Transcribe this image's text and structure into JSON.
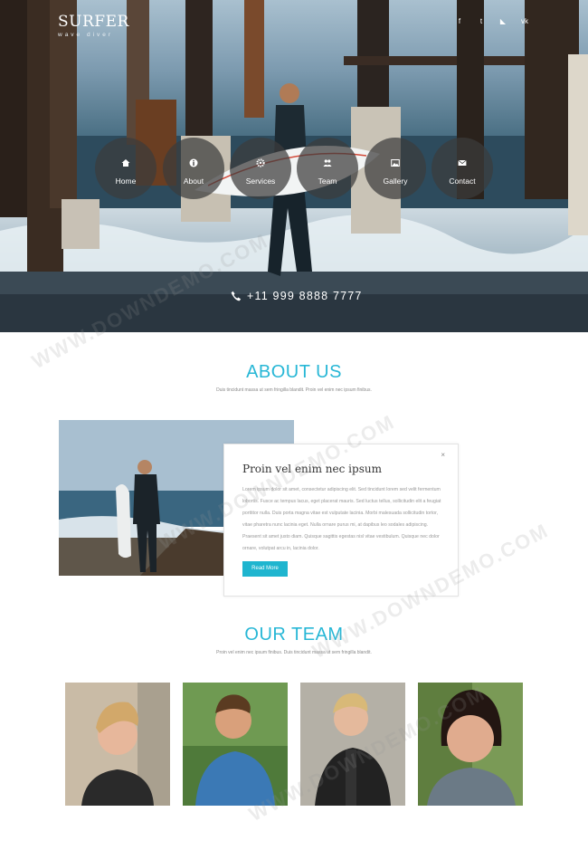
{
  "header": {
    "brand": "SURFER",
    "tagline": "wave diver",
    "social": [
      {
        "icon": "facebook-icon",
        "glyph": "f"
      },
      {
        "icon": "twitter-icon",
        "glyph": "t"
      },
      {
        "icon": "rss-icon",
        "glyph": "◣"
      },
      {
        "icon": "vk-icon",
        "glyph": "vk"
      }
    ]
  },
  "nav": [
    {
      "label": "Home",
      "icon": "home-icon"
    },
    {
      "label": "About",
      "icon": "info-icon"
    },
    {
      "label": "Services",
      "icon": "gear-icon"
    },
    {
      "label": "Team",
      "icon": "users-icon"
    },
    {
      "label": "Gallery",
      "icon": "picture-icon"
    },
    {
      "label": "Contact",
      "icon": "envelope-icon"
    }
  ],
  "hero": {
    "phone": "+11 999 8888 7777"
  },
  "about": {
    "title": "ABOUT US",
    "subtitle": "Duis tincidunt massa ut sem fringilla blandit. Proin vel enim nec ipsum finibus.",
    "card_title": "Proin vel enim nec ipsum",
    "card_text": "Lorem ipsum dolor sit amet, consectetur adipiscing elit. Sed tincidunt lorem sed velit fermentum lobortis. Fusce ac tempus lacus, eget placerat mauris. Sed luctus tellus, sollicitudin elit a feugiat porttitor nulla. Duis porta magna vitae est vulputate lacinia. Morbi malesuada sollicitudin tortor, vitae pharetra nunc lacinia eget. Nulla ornare purus mi, at dapibus leo sodales adipiscing. Praesent sit amet justo diam. Quisque sagittis egestas nisl vitae vestibulum. Quisque nec dolor ornare, volutpat arcu in, lacinia dolor.",
    "button": "Read More",
    "close": "×"
  },
  "team": {
    "title": "OUR TEAM",
    "subtitle": "Proin vel enim nec ipsum finibus. Duis tincidunt massa ut sem fringilla blandit."
  },
  "watermark": "WWW.DOWNDEMO.COM"
}
